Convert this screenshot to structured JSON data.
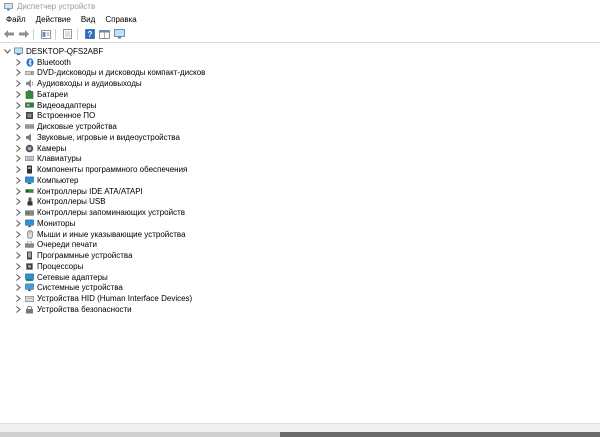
{
  "window": {
    "title": "Диспетчер устройств",
    "icon": "device-manager-icon"
  },
  "menu": [
    "Файл",
    "Действие",
    "Вид",
    "Справка"
  ],
  "toolbar": [
    "back-arrow-icon",
    "forward-arrow-icon",
    "properties-icon",
    "show-hidden-icon",
    "help-icon",
    "view-icon",
    "monitor-icon"
  ],
  "tree": {
    "root": "DESKTOP-QFS2ABF",
    "items": [
      {
        "label": "Bluetooth",
        "icon": "bluetooth-icon"
      },
      {
        "label": "DVD-дисководы и дисководы компакт-дисков",
        "icon": "dvd-drive-icon"
      },
      {
        "label": "Аудиовходы и аудиовыходы",
        "icon": "audio-io-icon"
      },
      {
        "label": "Батареи",
        "icon": "battery-icon"
      },
      {
        "label": "Видеоадаптеры",
        "icon": "video-adapter-icon"
      },
      {
        "label": "Встроенное ПО",
        "icon": "firmware-icon"
      },
      {
        "label": "Дисковые устройства",
        "icon": "disk-drive-icon"
      },
      {
        "label": "Звуковые, игровые и видеоустройства",
        "icon": "sound-icon"
      },
      {
        "label": "Камеры",
        "icon": "camera-icon"
      },
      {
        "label": "Клавиатуры",
        "icon": "keyboard-icon"
      },
      {
        "label": "Компоненты программного обеспечения",
        "icon": "software-component-icon"
      },
      {
        "label": "Компьютер",
        "icon": "computer-icon"
      },
      {
        "label": "Контроллеры IDE ATA/ATAPI",
        "icon": "ide-controller-icon"
      },
      {
        "label": "Контроллеры USB",
        "icon": "usb-icon"
      },
      {
        "label": "Контроллеры запоминающих устройств",
        "icon": "storage-controller-icon"
      },
      {
        "label": "Мониторы",
        "icon": "monitor-icon"
      },
      {
        "label": "Мыши и иные указывающие устройства",
        "icon": "mouse-icon"
      },
      {
        "label": "Очереди печати",
        "icon": "printer-icon"
      },
      {
        "label": "Программные устройства",
        "icon": "software-device-icon"
      },
      {
        "label": "Процессоры",
        "icon": "processor-icon"
      },
      {
        "label": "Сетевые адаптеры",
        "icon": "network-adapter-icon"
      },
      {
        "label": "Системные устройства",
        "icon": "system-device-icon"
      },
      {
        "label": "Устройства HID (Human Interface Devices)",
        "icon": "hid-icon"
      },
      {
        "label": "Устройства безопасности",
        "icon": "security-device-icon"
      }
    ]
  }
}
